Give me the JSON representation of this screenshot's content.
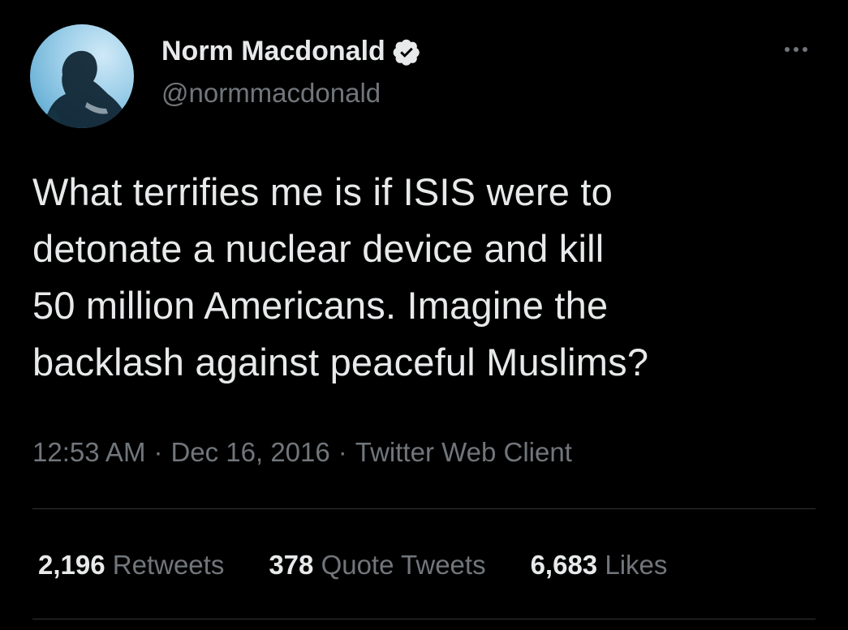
{
  "user": {
    "display_name": "Norm Macdonald",
    "handle": "@normmacdonald",
    "verified": true
  },
  "tweet": {
    "lines": [
      "What terrifies me is if ISIS were to",
      "detonate a nuclear device and kill",
      "50 million Americans. Imagine the",
      "backlash against peaceful Muslims?"
    ],
    "time": "12:53 AM",
    "date": "Dec 16, 2016",
    "source": "Twitter Web Client",
    "separator": "·"
  },
  "stats": {
    "retweets": {
      "count": "2,196",
      "label": "Retweets"
    },
    "quotes": {
      "count": "378",
      "label": "Quote Tweets"
    },
    "likes": {
      "count": "6,683",
      "label": "Likes"
    }
  },
  "icons": {
    "avatar": "avatar-silhouette",
    "verified": "verified-badge-icon",
    "more": "more-options-icon"
  },
  "colors": {
    "background": "#000000",
    "text": "#e7e9ea",
    "secondary": "#71767b",
    "divider": "#2f3336"
  }
}
